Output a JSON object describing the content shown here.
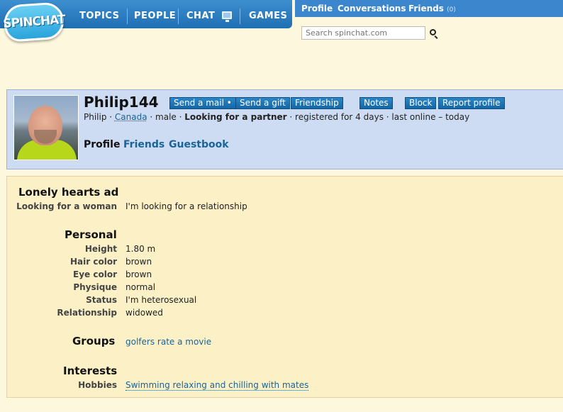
{
  "logo": {
    "text": "SPINCHAT"
  },
  "nav": {
    "topics": "TOPICS",
    "people": "PEOPLE",
    "chat": "CHAT",
    "games": "GAMES"
  },
  "userbar": {
    "profile": "Profile",
    "conversations": "Conversations",
    "friends": "Friends",
    "friends_count": "(0)"
  },
  "search": {
    "placeholder": "Search spinchat.com"
  },
  "profile": {
    "username": "Philip144",
    "buttons": {
      "send_mail": "Send a mail •",
      "send_gift": "Send a gift",
      "friendship": "Friendship",
      "notes": "Notes",
      "block": "Block",
      "report": "Report profile"
    },
    "meta": {
      "name": "Philip",
      "sep1": " · ",
      "location": "Canada",
      "sep2": " · ",
      "gender": "male",
      "sep3": " · ",
      "seeking": "Looking for a partner",
      "rest": " · registered for 4 days · last online – today"
    },
    "tabs": {
      "profile": "Profile",
      "friends": "Friends",
      "guestbook": "Guestbook"
    }
  },
  "details": {
    "lonely": {
      "title": "Lonely hearts ad",
      "label": "Looking for a woman",
      "value": "I'm looking for a relationship"
    },
    "personal": {
      "title": "Personal",
      "rows": [
        {
          "label": "Height",
          "value": "1.80 m"
        },
        {
          "label": "Hair color",
          "value": "brown"
        },
        {
          "label": "Eye color",
          "value": "brown"
        },
        {
          "label": "Physique",
          "value": "normal"
        },
        {
          "label": "Status",
          "value": "I'm heterosexual"
        },
        {
          "label": "Relationship",
          "value": "widowed"
        }
      ]
    },
    "groups": {
      "title": "Groups",
      "value": "golfers rate a movie"
    },
    "interests": {
      "title": "Interests",
      "label": "Hobbies",
      "value": "Swimming relaxing and chilling with mates"
    }
  }
}
